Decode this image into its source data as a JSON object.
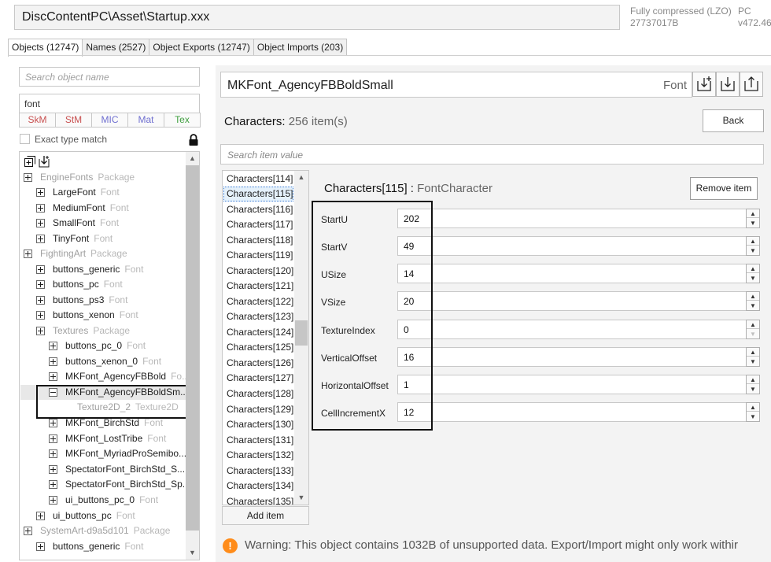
{
  "path": "DiscContentPC\\Asset\\Startup.xxx",
  "compression": {
    "line1": "Fully compressed (LZO)",
    "line2": "27737017B"
  },
  "platform": {
    "line1": "PC",
    "line2": "v472.46"
  },
  "tabs": [
    "Objects (12747)",
    "Names (2527)",
    "Object Exports (12747)",
    "Object Imports (203)"
  ],
  "left": {
    "search_placeholder": "Search object name",
    "type_filter_value": "font",
    "type_buttons": [
      {
        "label": "SkM",
        "color": "#c85050"
      },
      {
        "label": "StM",
        "color": "#c85050"
      },
      {
        "label": "MIC",
        "color": "#6f6fd0"
      },
      {
        "label": "Mat",
        "color": "#6f6fd0"
      },
      {
        "label": "Tex",
        "color": "#3f9f3f"
      }
    ],
    "exact_label": "Exact type match",
    "tree": [
      {
        "name": "EngineFonts",
        "type": "Package",
        "faded": true
      },
      {
        "name": "LargeFont",
        "type": "Font"
      },
      {
        "name": "MediumFont",
        "type": "Font"
      },
      {
        "name": "SmallFont",
        "type": "Font"
      },
      {
        "name": "TinyFont",
        "type": "Font"
      },
      {
        "name": "FightingArt",
        "type": "Package",
        "faded": true
      },
      {
        "name": "buttons_generic",
        "type": "Font"
      },
      {
        "name": "buttons_pc",
        "type": "Font"
      },
      {
        "name": "buttons_ps3",
        "type": "Font"
      },
      {
        "name": "buttons_xenon",
        "type": "Font"
      },
      {
        "name": "Textures",
        "type": "Package",
        "faded": true
      },
      {
        "name": "buttons_pc_0",
        "type": "Font"
      },
      {
        "name": "buttons_xenon_0",
        "type": "Font"
      },
      {
        "name": "MKFont_AgencyFBBold",
        "type": "Fo..."
      },
      {
        "name": "MKFont_AgencyFBBoldSm...",
        "type": ""
      },
      {
        "name": "Texture2D_2",
        "type": "Texture2D",
        "faded": true
      },
      {
        "name": "MKFont_BirchStd",
        "type": "Font"
      },
      {
        "name": "MKFont_LostTribe",
        "type": "Font"
      },
      {
        "name": "MKFont_MyriadProSemibo...",
        "type": ""
      },
      {
        "name": "SpectatorFont_BirchStd_S...",
        "type": ""
      },
      {
        "name": "SpectatorFont_BirchStd_Sp...",
        "type": ""
      },
      {
        "name": "ui_buttons_pc_0",
        "type": "Font"
      },
      {
        "name": "ui_buttons_pc",
        "type": "Font"
      },
      {
        "name": "SystemArt-d9a5d101",
        "type": "Package",
        "faded": true
      },
      {
        "name": "buttons_generic",
        "type": "Font"
      }
    ]
  },
  "object": {
    "name": "MKFont_AgencyFBBoldSmall",
    "class": "Font"
  },
  "characters": {
    "label": "Characters",
    "count": "256 item(s)"
  },
  "back_label": "Back",
  "search_item_placeholder": "Search item value",
  "list_items": [
    "Characters[114]",
    "Characters[115]",
    "Characters[116]",
    "Characters[117]",
    "Characters[118]",
    "Characters[119]",
    "Characters[120]",
    "Characters[121]",
    "Characters[122]",
    "Characters[123]",
    "Characters[124]",
    "Characters[125]",
    "Characters[126]",
    "Characters[127]",
    "Characters[128]",
    "Characters[129]",
    "Characters[130]",
    "Characters[131]",
    "Characters[132]",
    "Characters[133]",
    "Characters[134]",
    "Characters[135]"
  ],
  "add_item_label": "Add item",
  "detail": {
    "name": "Characters[115]",
    "sep": " : ",
    "type": "FontCharacter"
  },
  "remove_item_label": "Remove item",
  "properties": [
    {
      "label": "StartU",
      "value": "202"
    },
    {
      "label": "StartV",
      "value": "49"
    },
    {
      "label": "USize",
      "value": "14"
    },
    {
      "label": "VSize",
      "value": "20"
    },
    {
      "label": "TextureIndex",
      "value": "0"
    },
    {
      "label": "VerticalOffset",
      "value": "16"
    },
    {
      "label": "HorizontalOffset",
      "value": "1"
    },
    {
      "label": "CellIncrementX",
      "value": "12"
    }
  ],
  "warning_icon": "!",
  "warning": "Warning: This object contains 1032B of unsupported data. Export/Import might only work withir"
}
